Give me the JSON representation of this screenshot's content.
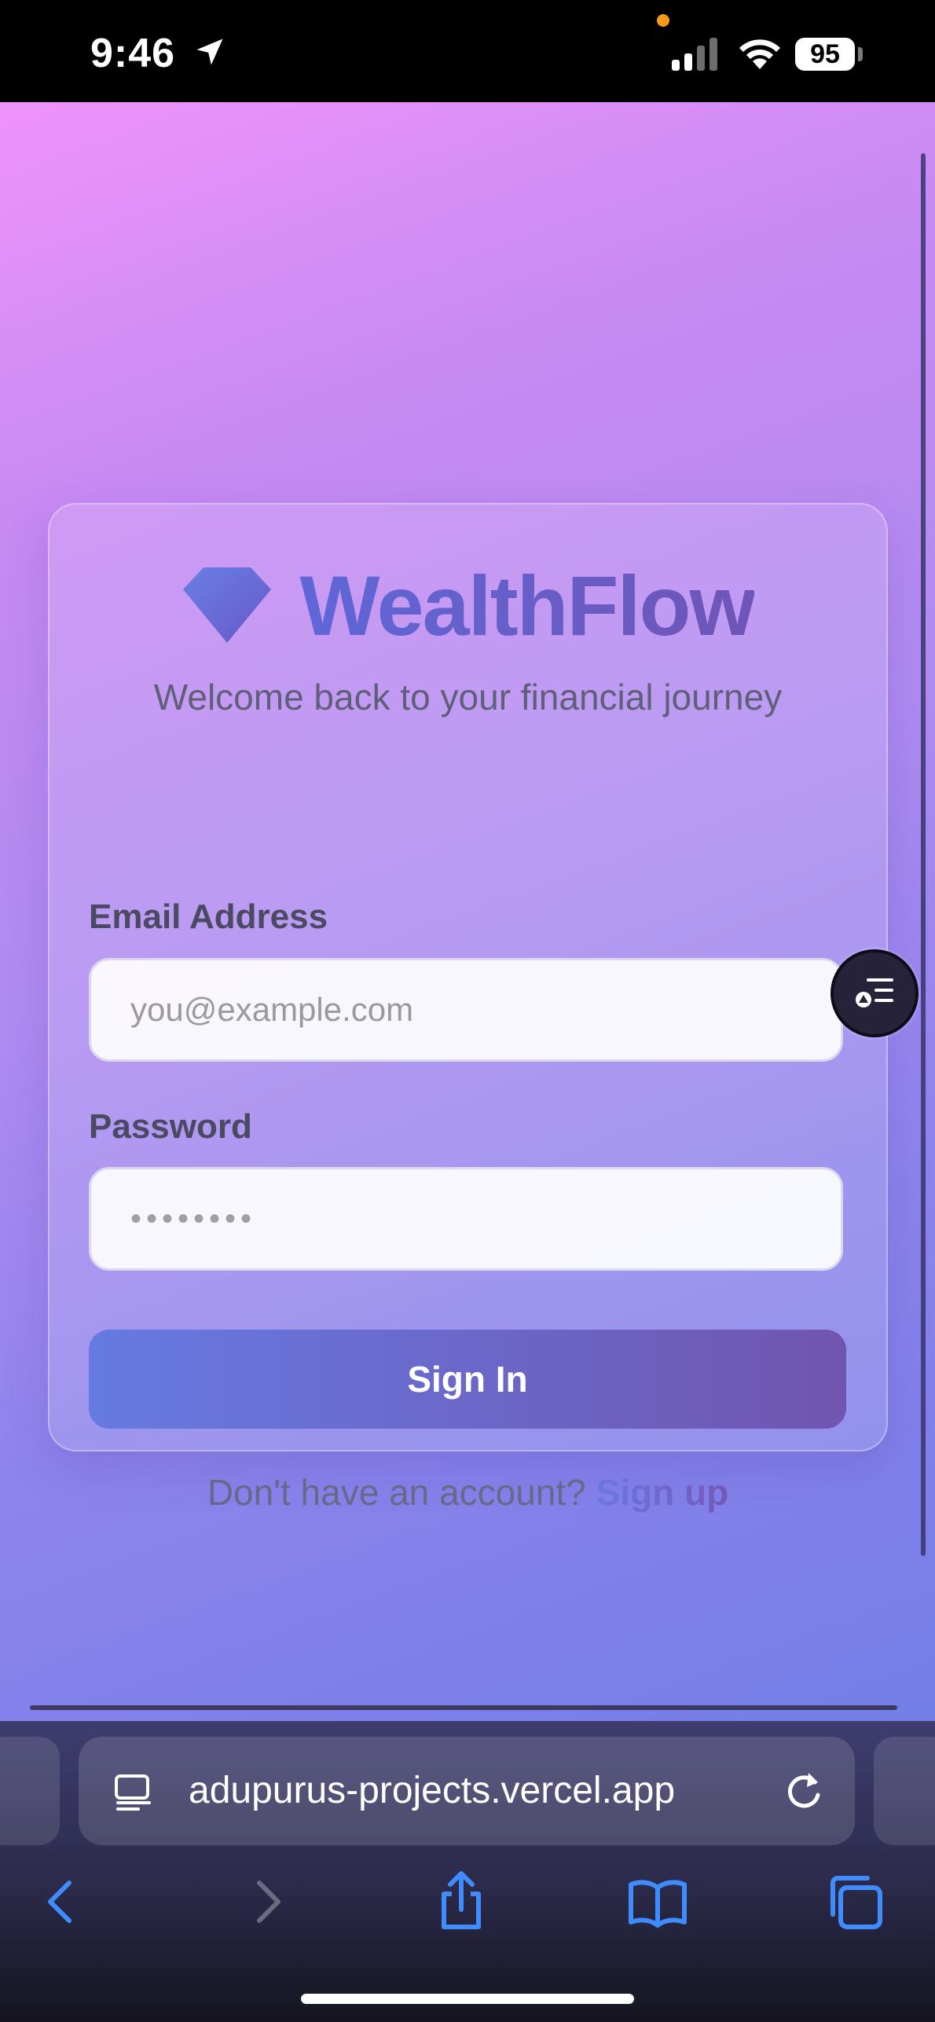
{
  "status_bar": {
    "time": "9:46",
    "battery": "95",
    "icons": [
      "location-arrow-icon",
      "signal-icon",
      "wifi-icon",
      "battery-icon"
    ]
  },
  "app": {
    "brand": "WealthFlow",
    "tagline": "Welcome back to your financial journey",
    "logo_icon": "diamond-icon",
    "email": {
      "label": "Email Address",
      "placeholder": "you@example.com",
      "value": ""
    },
    "password": {
      "label": "Password",
      "placeholder": "••••••••",
      "value": ""
    },
    "sign_in_label": "Sign In",
    "signup_prompt": "Don't have an account?",
    "signup_link": "Sign up"
  },
  "browser": {
    "url": "adupurus-projects.vercel.app",
    "toolbar_icons": [
      "back-icon",
      "forward-icon",
      "share-icon",
      "bookmarks-icon",
      "tabs-icon"
    ]
  },
  "colors": {
    "accent": "#667ae2",
    "brand_gradient_end": "#7055b0",
    "safari_blue": "#3f8cff"
  }
}
